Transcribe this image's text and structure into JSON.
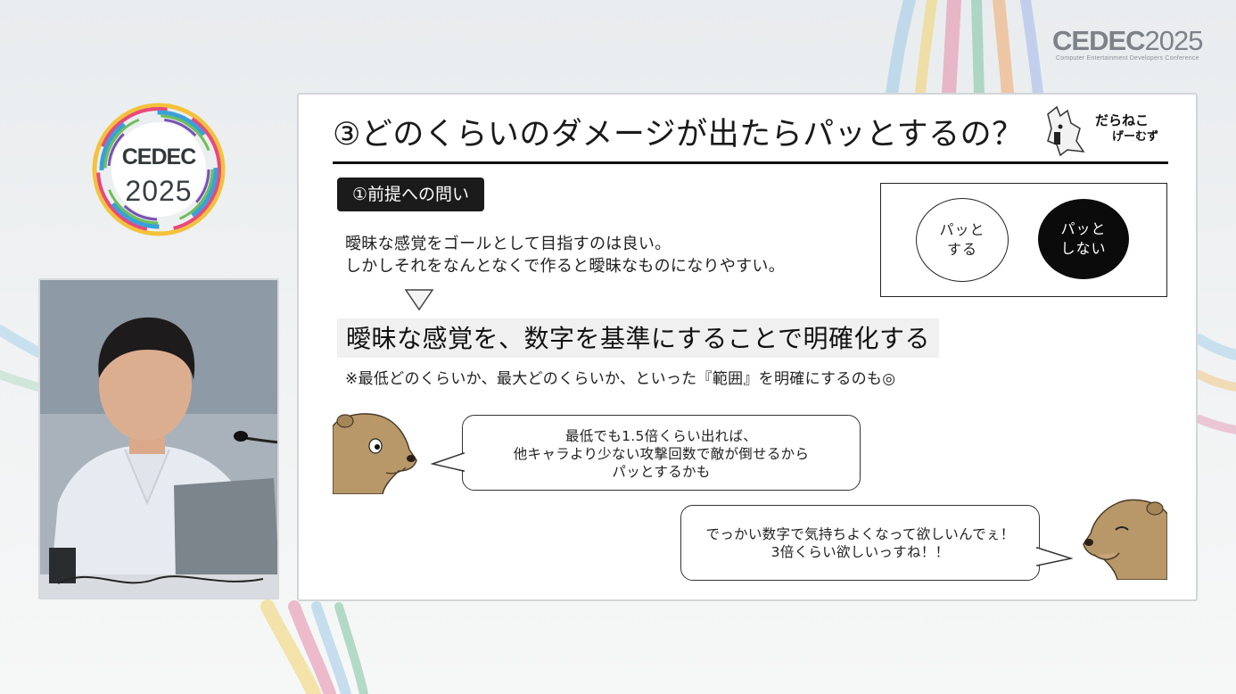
{
  "event_logo": {
    "name": "CEDEC",
    "year": "2025",
    "subtitle": "Computer Entertainment Developers Conference"
  },
  "slide": {
    "title": "③どのくらいのダメージが出たらパッとするの？",
    "brand_line1": "だらねこ",
    "brand_line2": "げーむず",
    "section_label": "①前提への問い",
    "body_line1": "曖昧な感覚をゴールとして目指すのは良い。",
    "body_line2": "しかしそれをなんとなくで作ると曖昧なものになりやすい。",
    "highlight": "曖昧な感覚を、数字を基準にすることで明確化する",
    "note": "※最低どのくらいか、最大どのくらいか、といった『範囲』を明確にするのも◎",
    "oval_a_line1": "パッと",
    "oval_a_line2": "する",
    "oval_b_line1": "パッと",
    "oval_b_line2": "しない",
    "bubble1": [
      "最低でも1.5倍くらい出れば、",
      "他キャラより少ない攻撃回数で敵が倒せるから",
      "パッとするかも"
    ],
    "bubble2": [
      "でっかい数字で気持ちよくなって欲しいんでぇ！",
      "3倍くらい欲しいっすね！！"
    ]
  },
  "colors": {
    "background": "#eef0f1",
    "slide_bg": "#ffffff",
    "text": "#1a1a1a",
    "label_bg": "#1b1b1b",
    "highlight_bg": "#f0f0f0",
    "character_fur": "#b89868"
  }
}
